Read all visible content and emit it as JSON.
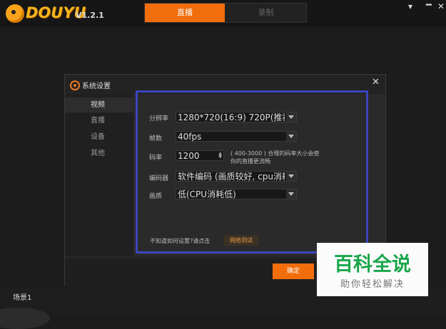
{
  "app": {
    "logo_text": "DOUYU",
    "version": "V1.2.1"
  },
  "tabs": [
    {
      "label": "直播"
    },
    {
      "label": "录制"
    }
  ],
  "window_controls": {
    "menu": "▾",
    "minimize": "━",
    "close": "✕"
  },
  "dialog": {
    "title": "系统设置",
    "close": "✕",
    "sidebar": [
      {
        "label": "视频"
      },
      {
        "label": "直播"
      },
      {
        "label": "设备"
      },
      {
        "label": "其他"
      }
    ],
    "settings": {
      "resolution": {
        "label": "分辨率",
        "value": "1280*720(16:9) 720P(推荐"
      },
      "fps": {
        "label": "帧数",
        "value": "40fps"
      },
      "bitrate": {
        "label": "码率",
        "value": "1200",
        "hint_line1": "( 400-3000 ) 合理的码率大小会使",
        "hint_line2": "你的直播更流畅"
      },
      "encoder": {
        "label": "编码器",
        "value": "软件编码 (画质较好, cpu消耗"
      },
      "quality": {
        "label": "画质",
        "value": "低(CPU消耗低)"
      }
    },
    "help_text": "不知道如何设置?请点击",
    "network_test": "网络测试",
    "confirm": "确定"
  },
  "scene": {
    "label": "场景1"
  },
  "watermark": {
    "title": "百科全说",
    "subtitle": "助你轻松解决"
  },
  "colors": {
    "accent": "#f26d0c",
    "highlight": "#3b45bd",
    "watermark_green": "#1aa64b"
  },
  "icons": [
    "logo-icon",
    "gear-icon",
    "close-icon",
    "chevron-down-icon",
    "spinner-arrows-icon",
    "menu-icon",
    "minimize-icon"
  ]
}
